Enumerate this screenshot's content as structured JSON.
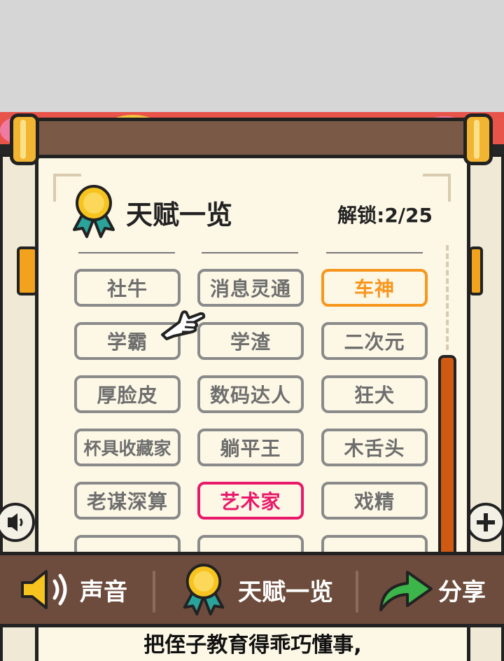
{
  "panel": {
    "title": "天赋一览",
    "unlock_label": "解锁:",
    "unlock_count": "2/25"
  },
  "talents": [
    {
      "label": "社牛",
      "state": "locked"
    },
    {
      "label": "消息灵通",
      "state": "locked"
    },
    {
      "label": "车神",
      "state": "unlocked"
    },
    {
      "label": "学霸",
      "state": "locked"
    },
    {
      "label": "学渣",
      "state": "locked"
    },
    {
      "label": "二次元",
      "state": "locked"
    },
    {
      "label": "厚脸皮",
      "state": "locked"
    },
    {
      "label": "数码达人",
      "state": "locked"
    },
    {
      "label": "狂犬",
      "state": "locked"
    },
    {
      "label": "杯具收藏家",
      "state": "locked"
    },
    {
      "label": "躺平王",
      "state": "locked"
    },
    {
      "label": "木舌头",
      "state": "locked"
    },
    {
      "label": "老谋深算",
      "state": "locked"
    },
    {
      "label": "艺术家",
      "state": "unlocked"
    },
    {
      "label": "戏精",
      "state": "locked"
    }
  ],
  "bottom_bar": {
    "sound_label": "声音",
    "talents_label": "天赋一览",
    "share_label": "分享"
  },
  "bottom_text": {
    "line1": "把侄子教育得乖巧懂事,"
  },
  "colors": {
    "locked": "#8a8a8a",
    "unlocked_orange": "#f7961f",
    "unlocked_pink": "#e8196a",
    "bar_brown": "#6d4c3d",
    "scrollbar": "#d05a12"
  }
}
